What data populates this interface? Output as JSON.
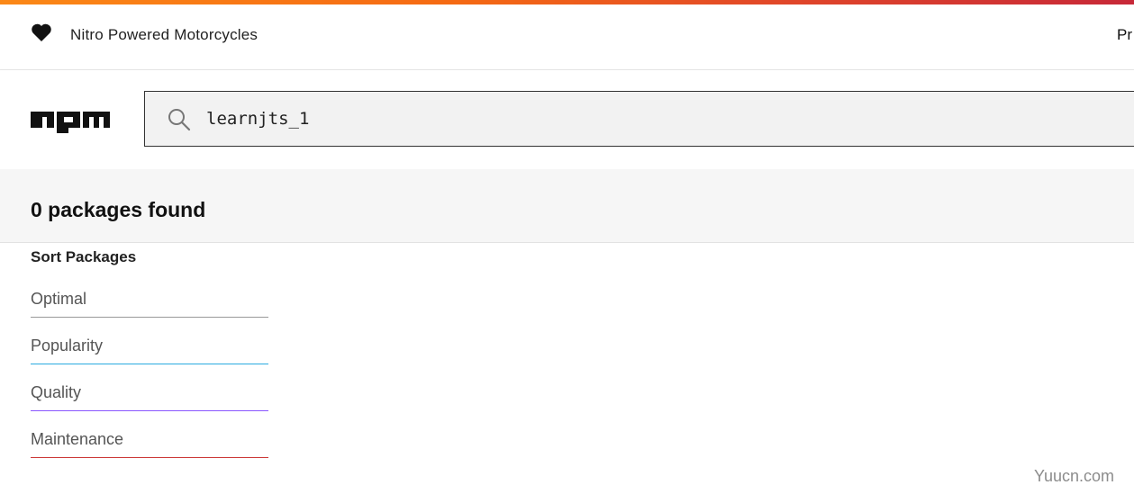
{
  "promo": {
    "icon": "heart-icon",
    "text": "Nitro Powered Motorcycles",
    "right_text": "Pr"
  },
  "header": {
    "logo_text": "npm",
    "search": {
      "icon": "search-icon",
      "value": "learnjts_1"
    }
  },
  "results": {
    "count_text": "0 packages found"
  },
  "sort": {
    "title": "Sort Packages",
    "options": [
      {
        "label": "Optimal",
        "color": "#999999"
      },
      {
        "label": "Popularity",
        "color": "#29abe0"
      },
      {
        "label": "Quality",
        "color": "#8956ff"
      },
      {
        "label": "Maintenance",
        "color": "#cb3837"
      }
    ]
  },
  "watermark": "Yuucn.com"
}
